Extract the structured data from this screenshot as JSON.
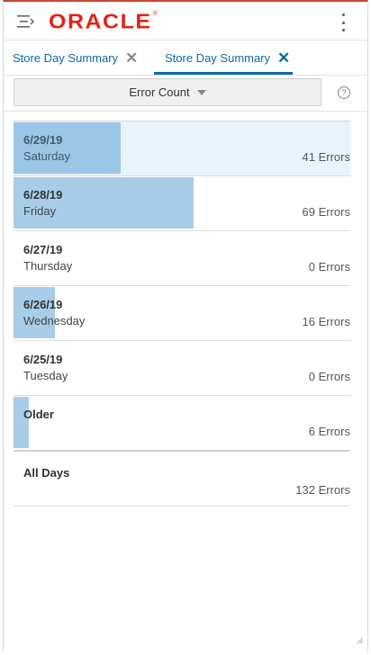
{
  "header": {
    "logo_text": "ORACLE",
    "logo_mark": "®",
    "menu_icon": "hamburger-menu-icon",
    "overflow_icon": "kebab-menu-icon",
    "accent_color": "#c74634"
  },
  "tabs": [
    {
      "label": "Store Day Summary",
      "active": false
    },
    {
      "label": "Store Day Summary",
      "active": true
    }
  ],
  "filter": {
    "selected": "Error Count",
    "help_symbol": "?"
  },
  "rows": [
    {
      "date": "6/29/19",
      "day": "Saturday",
      "count_label": "41 Errors",
      "errors": 41,
      "selected": true
    },
    {
      "date": "6/28/19",
      "day": "Friday",
      "count_label": "69 Errors",
      "errors": 69,
      "selected": false
    },
    {
      "date": "6/27/19",
      "day": "Thursday",
      "count_label": "0 Errors",
      "errors": 0,
      "selected": false
    },
    {
      "date": "6/26/19",
      "day": "Wednesday",
      "count_label": "16 Errors",
      "errors": 16,
      "selected": false
    },
    {
      "date": "6/25/19",
      "day": "Tuesday",
      "count_label": "0 Errors",
      "errors": 0,
      "selected": false
    },
    {
      "date": "Older",
      "day": "",
      "count_label": "6 Errors",
      "errors": 6,
      "selected": false
    }
  ],
  "total": {
    "label": "All Days",
    "count_label": "132 Errors",
    "errors": 132
  },
  "colors": {
    "link": "#0a6aa1",
    "bar": "#a8cde8",
    "selected_row": "#e8f3fb"
  }
}
